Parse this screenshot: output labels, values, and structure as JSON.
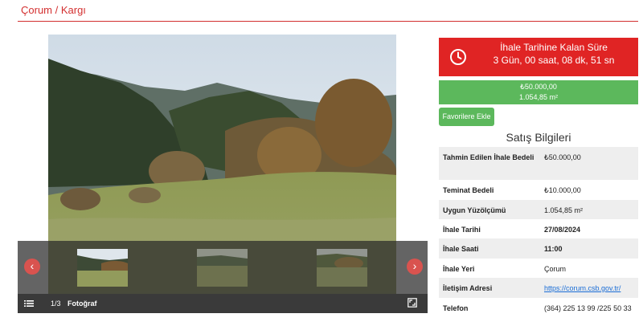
{
  "breadcrumb": {
    "text": "Çorum / Kargı"
  },
  "gallery": {
    "counter": "1/3",
    "label": "Fotoğraf",
    "prev_icon": "chevron-left-icon",
    "next_icon": "chevron-right-icon",
    "menu_icon": "list-icon",
    "fullscreen_icon": "fullscreen-icon"
  },
  "countdown": {
    "title": "İhale Tarihine Kalan Süre",
    "value": "3 Gün, 00 saat, 08 dk, 51 sn",
    "icon": "clock-icon",
    "color": "#e02424"
  },
  "price": {
    "amount": "₺50.000,00",
    "area": "1.054,85 m²",
    "color": "#5cb85c"
  },
  "favorite_button": {
    "label": "Favorilere Ekle"
  },
  "sales_info": {
    "title": "Satış Bilgileri",
    "rows": [
      {
        "key": "Tahmin Edilen İhale Bedeli",
        "value": "₺50.000,00"
      },
      {
        "key": "Teminat Bedeli",
        "value": "₺10.000,00"
      },
      {
        "key": "Uygun Yüzölçümü",
        "value": "1.054,85 m²"
      },
      {
        "key": "İhale Tarihi",
        "value": "27/08/2024"
      },
      {
        "key": "İhale Saati",
        "value": "11:00"
      },
      {
        "key": "İhale Yeri",
        "value": "Çorum"
      },
      {
        "key": "İletişim Adresi",
        "value": "https://corum.csb.gov.tr/"
      },
      {
        "key": "Telefon",
        "value": "(364) 225 13 99 /225 50 33"
      }
    ]
  }
}
